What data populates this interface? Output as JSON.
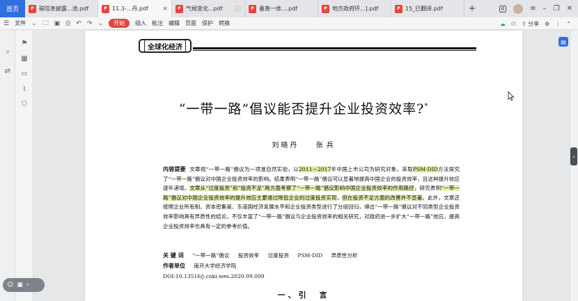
{
  "tabs": {
    "home": "首页",
    "items": [
      {
        "label": "碳信息披露...池.pdf",
        "active": false,
        "close": ""
      },
      {
        "label": "11.3-...丹.pdf",
        "active": true,
        "close": "×"
      },
      {
        "label": "气候变化...pdf",
        "active": false,
        "close": "",
        "warn": "ⓘ"
      },
      {
        "label": "垂直一体....pdf",
        "active": false,
        "close": ""
      },
      {
        "label": "地方政府环...].pdf",
        "active": false,
        "close": ""
      },
      {
        "label": "15_已翻译.pdf",
        "active": false,
        "close": ""
      }
    ],
    "add": "+",
    "badge": "6"
  },
  "toolbar": {
    "file_menu": "文件",
    "start": "开始",
    "insert": "插入",
    "annotate": "批注",
    "edit": "编辑",
    "page": "页面",
    "protect": "保护",
    "convert": "转换",
    "share": "分享"
  },
  "paper": {
    "column_tag": "全球化经济",
    "title": "“一带一路”倡议能否提升企业投资效率?",
    "title_mark": "*",
    "authors": [
      "刘晓丹",
      "张",
      "兵"
    ],
    "abstract_label": "内容提要",
    "abstract_parts": {
      "p1": "文章视“一带一路”倡议为一项准自然实验，以",
      "p1_hl": "2011－2017",
      "p2": "年中国上市公司为研究对象，采取",
      "p2_hl": "PSM-DID",
      "p3": "方法探究了“一带一路”倡议对中国企业投资效率的影响。结果表明“一带一路”倡议可以显著地提高中国企业的投资效率，且这种提升效应逐年递增。",
      "p3_hl": "文章从“过度投资”和“投资不足”两方面考察了“一带一路”倡议影响中国企业投资效率的作用路径",
      "p4": "，研究表明",
      "p4_hl": "“一带一路”倡议对中国企业投资效率的提升效应主要通过降低企业的过度投资实现",
      "p5": "，",
      "p5_hl": "但在投资不足方面的改善并不显著",
      "p6": "。此外，文章还按照企业所有制、资本密集度、东道国经济发展水平和企业投资类型进行了分组回归，得出“一带一路”倡议对不同类型企业投资效率影响具有异质性的结论，不仅丰富了“一带一路”倡议与企业投资效率的相关研究，对政府进一步扩大“一带一路”效应，提高企业投资效率也具有一定的参考价值。"
    },
    "keywords_label": "关 键 词",
    "keywords": [
      "“一带一路”倡议",
      "投资效率",
      "过度投资",
      "PSM-DID",
      "异质性分析"
    ],
    "affiliation_label": "作者单位",
    "affiliation": "南开大学经济学院",
    "doi": "DOI:10.13516/j.cnki.wes.2020.09.009",
    "section_head": "一、引　言"
  }
}
